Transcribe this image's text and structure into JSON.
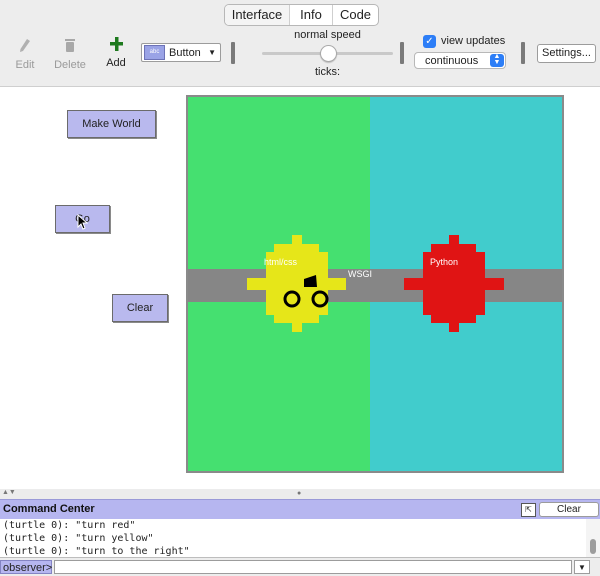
{
  "tabs": [
    "Interface",
    "Info",
    "Code"
  ],
  "toolbar": {
    "edit_label": "Edit",
    "delete_label": "Delete",
    "add_label": "Add",
    "widget_type": "Button",
    "widget_icon_text": "abc",
    "speed_label": "normal speed",
    "speed_fraction": 0.5,
    "ticks_label": "ticks:",
    "view_updates_label": "view updates",
    "view_updates_checked": true,
    "update_mode": "continuous",
    "settings_label": "Settings..."
  },
  "buttons": {
    "make_world": "Make World",
    "go": "Go",
    "clear": "Clear"
  },
  "world": {
    "left_color": "#45e070",
    "right_color": "#41cccc",
    "road_color": "#868686",
    "road_label": "WSGI",
    "turtle_yellow": {
      "label": "html/css",
      "color": "#e6e619"
    },
    "turtle_red": {
      "label": "Python",
      "color": "#e01414"
    }
  },
  "command_center": {
    "title": "Command Center",
    "clear_label": "Clear",
    "output": [
      "(turtle 0): \"turn red\"",
      "(turtle 0): \"turn yellow\"",
      "(turtle 0): \"turn to the right\""
    ],
    "agent_prompt": "observer>",
    "input_value": ""
  }
}
